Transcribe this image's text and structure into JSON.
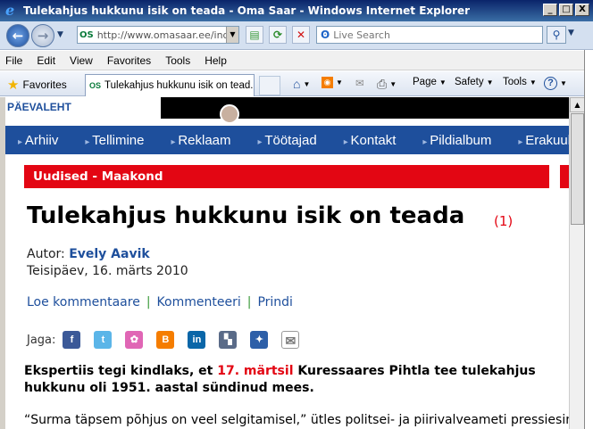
{
  "window": {
    "title": "Tulekahjus hukkunu isik on teada - Oma Saar - Windows Internet Explorer",
    "min_glyph": "_",
    "max_glyph": "□",
    "close_glyph": "X"
  },
  "address_bar": {
    "back_glyph": "←",
    "forward_glyph": "→",
    "url": "http://www.omasaar.ee/inde",
    "search_placeholder": "Live Search"
  },
  "menu": [
    "File",
    "Edit",
    "View",
    "Favorites",
    "Tools",
    "Help"
  ],
  "favbar": {
    "favorites_label": "Favorites",
    "tab_title": "Tulekahjus hukkunu isik on tead...",
    "commands": [
      "Page",
      "Safety",
      "Tools"
    ]
  },
  "page": {
    "logo": "PÄEVALEHT",
    "nav": [
      "Arhiiv",
      "Tellimine",
      "Reklaam",
      "Töötajad",
      "Kontakt",
      "Pildialbum",
      "Erakuulutus"
    ],
    "section": "Uudised - Maakond",
    "headline": "Tulekahjus hukkunu isik on teada",
    "comment_count": "(1)",
    "author_label": "Autor:",
    "author_name": "Evely Aavik",
    "date": "Teisipäev, 16. märts 2010",
    "links": [
      "Loe kommentaare",
      "Kommenteeri",
      "Prindi"
    ],
    "share_label": "Jaga:",
    "share_icons": [
      {
        "name": "facebook-icon",
        "glyph": "f",
        "color": "#3b5998"
      },
      {
        "name": "twitter-icon",
        "glyph": "t",
        "color": "#5bb5e8"
      },
      {
        "name": "orkut-icon",
        "glyph": "✿",
        "color": "#e066b5"
      },
      {
        "name": "blogger-icon",
        "glyph": "B",
        "color": "#f57d00"
      },
      {
        "name": "linkedin-icon",
        "glyph": "in",
        "color": "#0a66a8"
      },
      {
        "name": "delicious-icon",
        "glyph": "▚",
        "color": "#5a6b88"
      },
      {
        "name": "myspace-icon",
        "glyph": "✦",
        "color": "#2d5fa8"
      },
      {
        "name": "email-icon",
        "glyph": "✉",
        "color": "#8a8a8a"
      }
    ],
    "lead_before": "Ekspertiis tegi kindlaks, et ",
    "lead_highlight": "17. märtsil",
    "lead_after": " Kuressaares Pihtla tee tulekahjus hukkunu oli 1951. aastal sündinud mees.",
    "body_start": "“Surma täpsem põhjus on veel selgitamisel,” ütles politsei- ja piirivalveameti pressiesindaja"
  },
  "colors": {
    "brand_blue": "#1e4f9c",
    "accent_red": "#e30613"
  }
}
